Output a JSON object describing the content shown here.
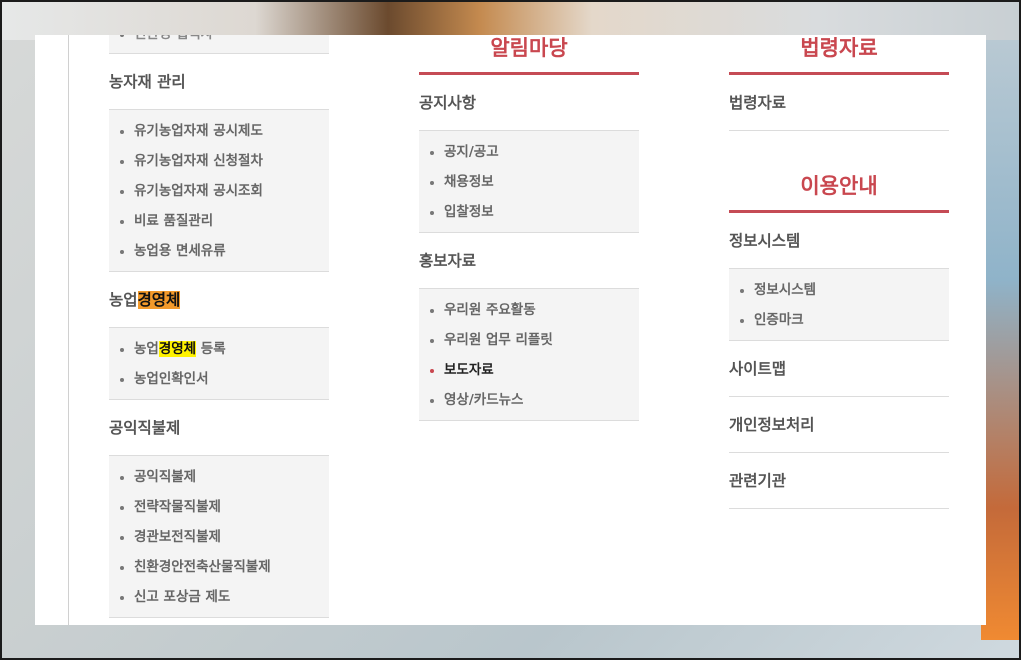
{
  "col1": {
    "partial_item": "친환경 협력사",
    "groups": [
      {
        "title": "농자재 관리",
        "items": [
          "유기농업자재 공시제도",
          "유기농업자재 신청절차",
          "유기농업자재 공시조회",
          "비료 품질관리",
          "농업용 면세유류"
        ]
      },
      {
        "title_prefix": "농업",
        "title_highlight": "경영체",
        "items_special": {
          "prefix": "농업",
          "highlight": "경영체",
          "suffix": " 등록"
        },
        "items": [
          "농업인확인서"
        ]
      },
      {
        "title": "공익직불제",
        "items": [
          "공익직불제",
          "전략작물직불제",
          "경관보전직불제",
          "친환경안전축산물직불제",
          "신고 포상금 제도"
        ]
      }
    ]
  },
  "col2": {
    "section_title": "알림마당",
    "groups": [
      {
        "title": "공지사항",
        "items": [
          "공지/공고",
          "채용정보",
          "입찰정보"
        ]
      },
      {
        "title": "홍보자료",
        "items": [
          "우리원 주요활동",
          "우리원 업무 리플릿",
          "보도자료",
          "영상/카드뉴스"
        ]
      }
    ]
  },
  "col3": {
    "section1_title": "법령자료",
    "section1_items": [
      "법령자료"
    ],
    "section2_title": "이용안내",
    "group_title": "정보시스템",
    "group_items": [
      "정보시스템",
      "인증마크"
    ],
    "links": [
      "사이트맵",
      "개인정보처리",
      "관련기관"
    ]
  },
  "colors": {
    "accent": "#c9474f",
    "highlight_orange": "#f39a2b",
    "highlight_yellow": "#fff200"
  }
}
